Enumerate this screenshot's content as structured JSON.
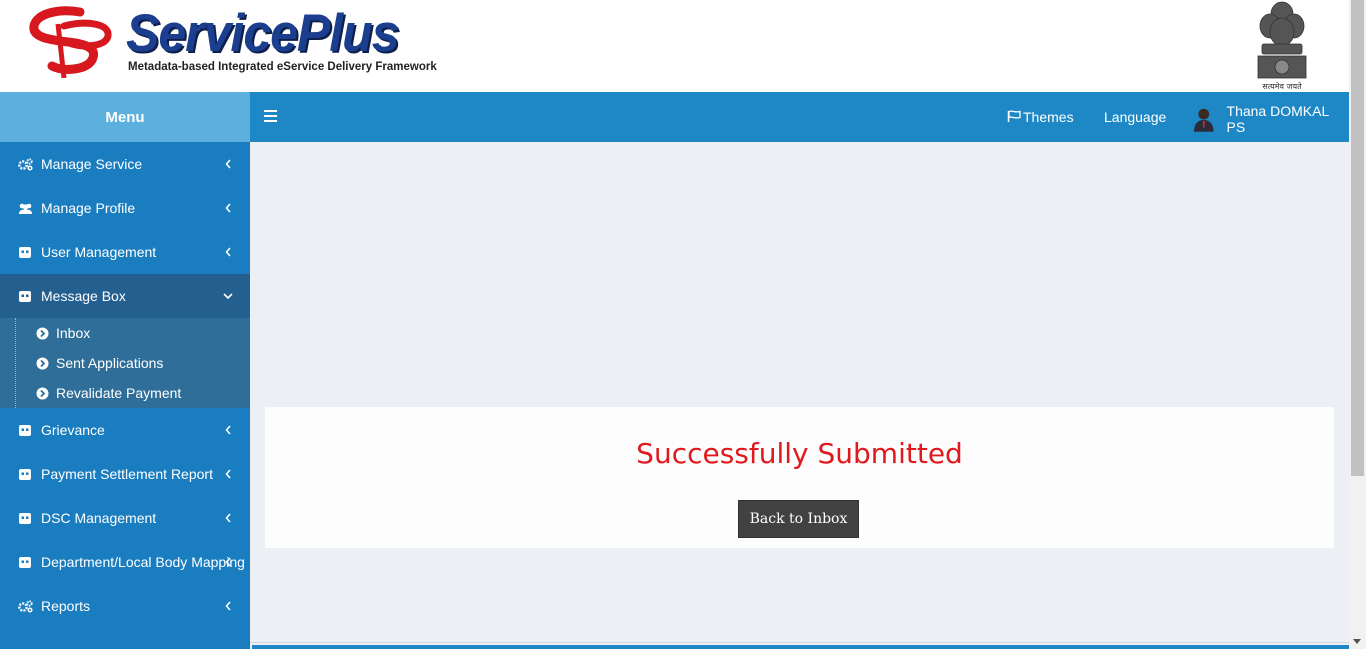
{
  "header": {
    "title": "ServicePlus",
    "tagline": "Metadata-based Integrated eService Delivery Framework",
    "emblem_caption": "सत्यमेव जयते"
  },
  "topbar": {
    "menu_label": "Menu",
    "themes_label": "Themes",
    "language_label": "Language",
    "user_name": "Thana DOMKAL PS"
  },
  "sidebar": {
    "items": [
      {
        "label": "Manage Service",
        "icon": "gears-icon"
      },
      {
        "label": "Manage Profile",
        "icon": "users-icon"
      },
      {
        "label": "User Management",
        "icon": "card-icon"
      },
      {
        "label": "Message Box",
        "icon": "card-icon",
        "expanded": true
      },
      {
        "label": "Grievance",
        "icon": "card-icon"
      },
      {
        "label": "Payment Settlement Report",
        "icon": "card-icon"
      },
      {
        "label": "DSC Management",
        "icon": "card-icon"
      },
      {
        "label": "Department/Local Body Mapping",
        "icon": "card-icon"
      },
      {
        "label": "Reports",
        "icon": "gears-icon"
      }
    ],
    "message_box_sub": [
      "Inbox",
      "Sent Applications",
      "Revalidate Payment"
    ]
  },
  "main": {
    "status_message": "Successfully Submitted",
    "back_button": "Back to Inbox"
  },
  "colors": {
    "topbar": "#1e88c7",
    "menu_head": "#5db0de",
    "sidebar": "#1a7dc0",
    "success_text": "#e0191f"
  }
}
